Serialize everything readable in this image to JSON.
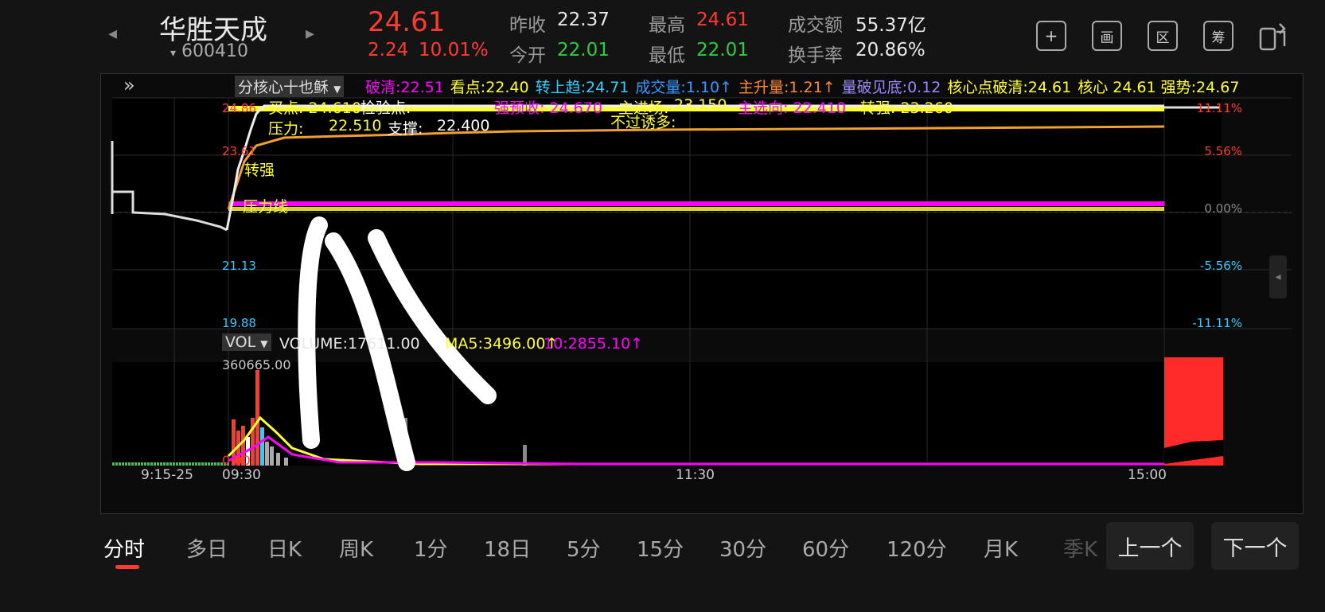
{
  "header": {
    "prev_arrow": "◂",
    "next_arrow": "▸",
    "stock_name": "华胜天成",
    "stock_code": "600410",
    "code_caret": "▾",
    "price": "24.61",
    "change": "2.24",
    "change_pct": "10.01%",
    "stats": [
      {
        "label": "昨收",
        "value": "22.37",
        "color": "#e8e8e8"
      },
      {
        "label": "今开",
        "value": "22.01",
        "color": "#2ecc40"
      },
      {
        "label": "最高",
        "value": "24.61",
        "color": "#ff3b30"
      },
      {
        "label": "最低",
        "value": "22.01",
        "color": "#2ecc40"
      },
      {
        "label": "成交额",
        "value": "55.37亿",
        "color": "#e8e8e8"
      },
      {
        "label": "换手率",
        "value": "20.86%",
        "color": "#e8e8e8"
      }
    ],
    "tool_icons": [
      "+",
      "画",
      "区",
      "筹"
    ]
  },
  "indicator_bar": {
    "expand": "»",
    "selector": "分核心十也稣",
    "items": [
      {
        "text": "破清:22.51",
        "color": "#ff00ff"
      },
      {
        "text": "看点:22.40",
        "color": "#ffff33"
      },
      {
        "text": "转上趋:24.71",
        "color": "#33ccff"
      },
      {
        "text": "成交量:1.10↑",
        "color": "#3399ff"
      },
      {
        "text": "主升量:1.21↑",
        "color": "#ff8833"
      },
      {
        "text": "量破见底:0.12",
        "color": "#9988ff"
      },
      {
        "text": "核心点破清:24.61",
        "color": "#ffff33"
      },
      {
        "text": "核心 24.61 强势:24.67",
        "color": "#ffff33"
      }
    ]
  },
  "price_axis": {
    "left": [
      {
        "text": "24.86",
        "color": "#ff3b30"
      },
      {
        "text": "23.61",
        "color": "#ff3b30"
      },
      {
        "text": "21.13",
        "color": "#33ccff"
      },
      {
        "text": "19.88",
        "color": "#33ccff"
      }
    ],
    "right": [
      {
        "text": "11.11%",
        "color": "#ff3b30"
      },
      {
        "text": "5.56%",
        "color": "#ff3b30"
      },
      {
        "text": "0.00%",
        "color": "#888888"
      },
      {
        "text": "-5.56%",
        "color": "#33ccff"
      },
      {
        "text": "-11.11%",
        "color": "#33ccff"
      }
    ]
  },
  "annotations": {
    "top_row": [
      {
        "text": "买点: 24.610",
        "color": "#ffff33"
      },
      {
        "text": "检验点:",
        "color": "#ffffff"
      },
      {
        "text": "强预收: 24.670",
        "color": "#ff00ff"
      },
      {
        "text": "主进场:",
        "color": "#ffff33"
      },
      {
        "text": "23.150",
        "color": "#ffff33"
      },
      {
        "text": "主选向: 22.410",
        "color": "#ff00ff"
      },
      {
        "text": "转强: 23.260",
        "color": "#ffff33"
      }
    ],
    "pressure": "压力:",
    "pressure_val": "22.510",
    "support": "支撑:",
    "support_val": "22.400",
    "not_trap": "不过诱多:",
    "zhuanqiang": "转强",
    "pressure_line": "压力线"
  },
  "volume_panel": {
    "selector": "VOL",
    "volume": "VOLUME:17611.00",
    "ma5": "MA5:3496.00↑",
    "ma10": "10:2855.10↑",
    "max_label": "360665.00",
    "zero_label": "0.00"
  },
  "time_axis": [
    "9:15-25",
    "09:30",
    "11:30",
    "15:00"
  ],
  "tabs": [
    "分时",
    "多日",
    "日K",
    "周K",
    "1分",
    "18日",
    "5分",
    "15分",
    "30分",
    "60分",
    "120分",
    "月K",
    "季K"
  ],
  "nav": {
    "prev": "上一个",
    "next": "下一个"
  },
  "colors": {
    "up": "#ff3b30",
    "down": "#2ecc40",
    "avg_line": "#f0a030",
    "yellow": "#ffff33",
    "magenta": "#ff00ff"
  }
}
